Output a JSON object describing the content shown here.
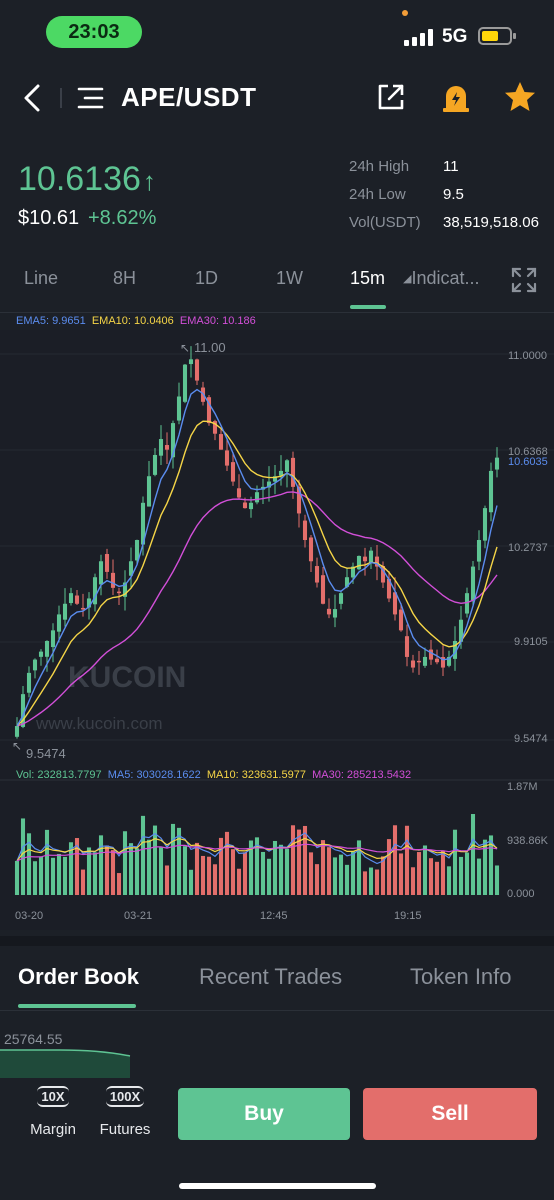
{
  "status_bar": {
    "time": "23:03",
    "network": "5G"
  },
  "header": {
    "pair": "APE/USDT"
  },
  "price": {
    "last": "10.6136",
    "fiat": "$10.61",
    "change": "+8.62%"
  },
  "stats": [
    {
      "label": "24h High",
      "value": "11"
    },
    {
      "label": "24h Low",
      "value": "9.5"
    },
    {
      "label": "Vol(USDT)",
      "value": "38,519,518.06"
    }
  ],
  "tabs": {
    "line": "Line",
    "h8": "8H",
    "d1": "1D",
    "w1": "1W",
    "m15": "15m",
    "indicators": "Indicat..."
  },
  "colors": {
    "up": "#5ec493",
    "down": "#e36e6b",
    "ema5": "#5b8def",
    "ema10": "#f5d547",
    "ema30": "#d24fd8"
  },
  "ema_legend": {
    "ema5": "EMA5: 9.9651",
    "ema10": "EMA10: 10.0406",
    "ema30": "EMA30: 10.186"
  },
  "price_axis": [
    "11.0000",
    "10.6368",
    "10.6035",
    "10.2737",
    "9.9105",
    "9.5474"
  ],
  "annotations": {
    "high": "11.00",
    "low": "9.5474"
  },
  "watermark": {
    "brand": "KUCOIN",
    "url": "www.kucoin.com"
  },
  "vol_legend": {
    "vol": "Vol: 232813.7797",
    "ma5": "MA5: 303028.1622",
    "ma10": "MA10: 323631.5977",
    "ma30": "MA30: 285213.5432"
  },
  "vol_axis": [
    "1.87M",
    "938.86K",
    "0.000"
  ],
  "time_axis": [
    "03-20",
    "03-21",
    "12:45",
    "19:15"
  ],
  "bottom_tabs": {
    "order_book": "Order Book",
    "recent_trades": "Recent Trades",
    "token_info": "Token Info"
  },
  "depth_price": "25764.55",
  "tools": {
    "margin_badge": "10X",
    "margin": "Margin",
    "futures_badge": "100X",
    "futures": "Futures"
  },
  "buttons": {
    "buy": "Buy",
    "sell": "Sell"
  },
  "chart_data": {
    "type": "candlestick",
    "interval": "15m",
    "price_range": [
      9.5474,
      11.0
    ],
    "close": [
      9.6,
      9.72,
      9.8,
      9.85,
      9.88,
      9.92,
      9.96,
      10.02,
      10.06,
      10.1,
      10.06,
      10.04,
      10.08,
      10.16,
      10.22,
      10.18,
      10.12,
      10.1,
      10.14,
      10.22,
      10.3,
      10.44,
      10.54,
      10.62,
      10.68,
      10.64,
      10.74,
      10.84,
      10.96,
      10.98,
      10.9,
      10.82,
      10.74,
      10.7,
      10.64,
      10.58,
      10.52,
      10.46,
      10.42,
      10.44,
      10.48,
      10.5,
      10.52,
      10.54,
      10.56,
      10.6,
      10.5,
      10.4,
      10.3,
      10.22,
      10.14,
      10.06,
      10.02,
      10.04,
      10.1,
      10.16,
      10.2,
      10.24,
      10.22,
      10.26,
      10.2,
      10.14,
      10.08,
      10.02,
      9.96,
      9.86,
      9.82,
      9.84,
      9.86,
      9.85,
      9.84,
      9.82,
      9.86,
      9.92,
      10.0,
      10.1,
      10.2,
      10.3,
      10.42,
      10.56,
      10.61
    ]
  }
}
